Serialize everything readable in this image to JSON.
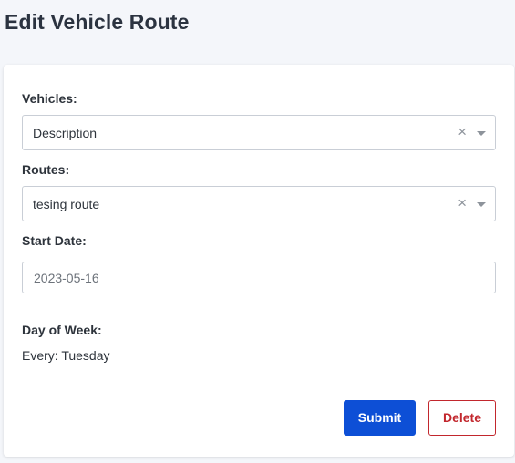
{
  "page": {
    "title": "Edit Vehicle Route"
  },
  "form": {
    "vehicles": {
      "label": "Vehicles:",
      "value": "Description",
      "clear_glyph": "×"
    },
    "routes": {
      "label": "Routes:",
      "value": "tesing route",
      "clear_glyph": "×"
    },
    "start_date": {
      "label": "Start Date:",
      "value": "2023-05-16"
    },
    "day_of_week": {
      "label": "Day of Week:",
      "value": "Every: Tuesday"
    }
  },
  "actions": {
    "submit_label": "Submit",
    "delete_label": "Delete"
  },
  "colors": {
    "primary": "#0d4fd6",
    "danger": "#c2272d",
    "background": "#f4f6fa"
  },
  "icons": {
    "clear": "close-icon",
    "dropdown": "chevron-down-icon"
  }
}
